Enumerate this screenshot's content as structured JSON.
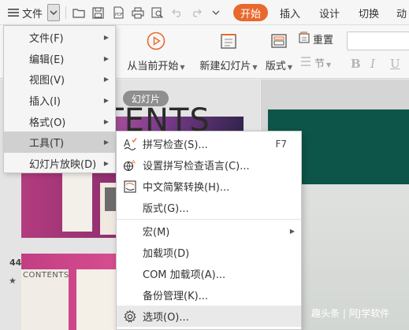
{
  "toolbar": {
    "file_label": "文件",
    "tabs": {
      "start": "开始",
      "insert": "插入",
      "design": "设计",
      "transition": "切换",
      "animation": "动"
    }
  },
  "ribbon": {
    "from_current": "从当前开始",
    "new_slide": "新建幻灯片",
    "layout": "版式",
    "reset": "重置",
    "section": "节"
  },
  "left_panel": {
    "slides_tab": "幻灯片",
    "slide_number": "44",
    "thumb_text": "CONTENTS"
  },
  "main": {
    "slide_title": "CONTENTS",
    "watermark": "趣头条 | 阿J学软件"
  },
  "file_menu": {
    "items": [
      {
        "label": "文件(F)"
      },
      {
        "label": "编辑(E)"
      },
      {
        "label": "视图(V)"
      },
      {
        "label": "插入(I)"
      },
      {
        "label": "格式(O)"
      },
      {
        "label": "工具(T)"
      },
      {
        "label": "幻灯片放映(D)"
      }
    ]
  },
  "tools_menu": {
    "items": [
      {
        "label": "拼写检查(S)...",
        "shortcut": "F7",
        "icon": "spellcheck-icon"
      },
      {
        "label": "设置拼写检查语言(C)...",
        "icon": "language-globe-icon"
      },
      {
        "label": "中文简繁转换(H)...",
        "icon": "chinese-convert-icon"
      },
      {
        "label": "版式(G)..."
      },
      {
        "label": "宏(M)"
      },
      {
        "label": "加载项(D)"
      },
      {
        "label": "COM 加载项(A)..."
      },
      {
        "label": "备份管理(K)..."
      },
      {
        "label": "选项(O)...",
        "icon": "gear-icon"
      }
    ]
  },
  "colors": {
    "accent": "#e8692d",
    "slide_teal": "#0d5548"
  }
}
